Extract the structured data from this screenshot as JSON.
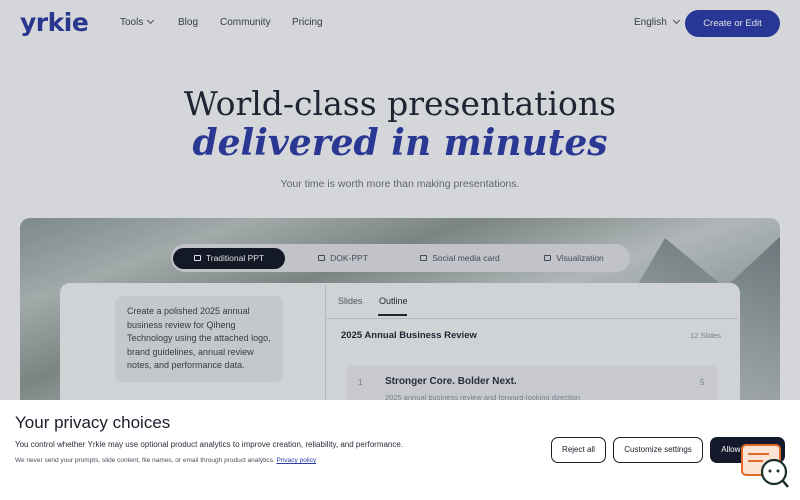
{
  "header": {
    "logo": "yrkie",
    "nav": [
      {
        "label": "Tools",
        "has_dropdown": true
      },
      {
        "label": "Blog"
      },
      {
        "label": "Community"
      },
      {
        "label": "Pricing"
      }
    ],
    "language": "English",
    "cta_label": "Create or Edit"
  },
  "hero": {
    "title": "World-class presentations",
    "title_emphasis": "delivered in minutes",
    "subtitle": "Your time is worth more than making presentations."
  },
  "mode_tabs": [
    {
      "label": "Traditional PPT",
      "active": true,
      "icon": "presentation-icon"
    },
    {
      "label": "DOK-PPT",
      "icon": "document-icon"
    },
    {
      "label": "Social media card",
      "icon": "card-icon"
    },
    {
      "label": "Visualization",
      "icon": "chart-icon"
    }
  ],
  "editor": {
    "prompt_text": "Create a polished 2025 annual business review for Qiheng Technology using the attached logo, brand guidelines, annual review notes, and performance data.",
    "view_tabs": [
      "Slides",
      "Outline"
    ],
    "active_view": "Outline",
    "deck_title": "2025 Annual Business Review",
    "slides_count": "12 Slides",
    "slide_number": "1",
    "slide_title": "Stronger Core. Bolder Next.",
    "slide_desc": "2025 annual business review and forward-looking direction",
    "slide_right_count": "5"
  },
  "consent": {
    "title": "Your privacy choices",
    "text": "You control whether Yrkie may use optional product analytics to improve creation, reliability, and performance.",
    "small_text": "We never send your prompts, slide content, file names, or email through product analytics.",
    "privacy_link": "Privacy policy",
    "reject_label": "Reject all",
    "customize_label": "Customize settings",
    "allow_label": "Allow analytics"
  },
  "colors": {
    "brand": "#2b3ba8",
    "dark": "#141a2b",
    "widget": "#e06a2a"
  },
  "widget_icon": "chat-support-icon"
}
